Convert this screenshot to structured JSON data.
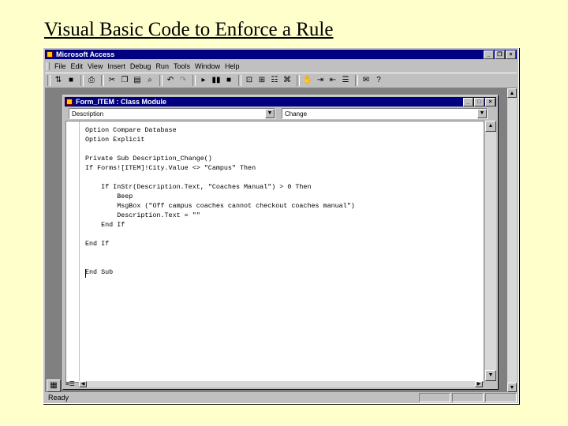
{
  "slide": {
    "title": "Visual Basic Code to Enforce a Rule"
  },
  "app": {
    "title": "Microsoft Access",
    "menu": [
      "File",
      "Edit",
      "View",
      "Insert",
      "Debug",
      "Run",
      "Tools",
      "Window",
      "Help"
    ],
    "status": "Ready"
  },
  "module": {
    "title": "Form_ITEM : Class Module",
    "object_combo": "Description",
    "proc_combo": "Change",
    "code": "Option Compare Database\nOption Explicit\n\nPrivate Sub Description_Change()\nIf Forms![ITEM]!City.Value <> \"Campus\" Then\n\n    If InStr(Description.Text, \"Coaches Manual\") > 0 Then\n        Beep\n        MsgBox (\"Off campus coaches cannot checkout coaches manual\")\n        Description.Text = \"\"\n    End If\n\nEnd If\n\n\nEnd Sub"
  },
  "icons": {
    "toolbar": [
      "view-access-icon",
      "save-icon",
      "print-icon",
      "cut-icon",
      "copy-icon",
      "paste-icon",
      "find-icon",
      "undo-icon",
      "redo-icon",
      "run-icon",
      "break-icon",
      "reset-icon",
      "design-mode-icon",
      "project-explorer-icon",
      "properties-icon",
      "object-browser-icon",
      "toolbox-icon",
      "help-icon"
    ]
  }
}
